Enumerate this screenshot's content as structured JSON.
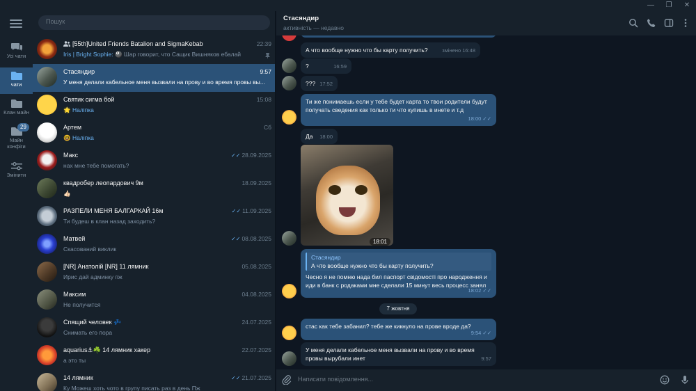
{
  "colors": {
    "accent": "#2b5278",
    "link": "#6ab2f2",
    "bg": "#0e1621",
    "panel": "#17212b"
  },
  "window": {
    "minimize": "—",
    "restore": "❐",
    "close": "✕"
  },
  "rail": {
    "badge": "29",
    "items": [
      {
        "label": "Усі чати",
        "icon": "chat-bubbles-icon"
      },
      {
        "label": "чати",
        "icon": "folder-icon"
      },
      {
        "label": "Клан майн",
        "icon": "folder-icon"
      },
      {
        "label": "Майн конфіги",
        "icon": "folder-icon"
      },
      {
        "label": "Змінити",
        "icon": "sliders-icon"
      }
    ]
  },
  "search": {
    "placeholder": "Пошук"
  },
  "chats": [
    {
      "name": "[55th]United Friends Batalion and SigmaKebab",
      "time": "22:39",
      "sender": "Iris | Bright Sophie:",
      "preview": "🎱 Шар говорит, что Сащик Вишняков ебалай"
    },
    {
      "name": "Стасяндир",
      "time": "9:57",
      "preview": "У меня делали кабельное меня вызвали на прову и во время провы вы..."
    },
    {
      "name": "Святик сигма бой",
      "time": "15:08",
      "preview": "🌟 Наліпка"
    },
    {
      "name": "Артем",
      "time": "Сб",
      "preview": "🤓 Наліпка"
    },
    {
      "name": "Макс",
      "time": "28.09.2025",
      "preview": "нах мне тебе помогать?"
    },
    {
      "name": "квадробер леопардович 9м",
      "time": "18.09.2025",
      "preview": "👍🏻"
    },
    {
      "name": "РАЗПЕЛИ МЕНЯ БАЛГАРКАЙ 16м",
      "time": "11.09.2025",
      "preview": "Ти будеш в клан назад заходить?"
    },
    {
      "name": "Матвей",
      "time": "08.08.2025",
      "preview": "Скасований виклик"
    },
    {
      "name": "[NR] Анатолій [NR] 11 лямник",
      "time": "05.08.2025",
      "preview": "Ирис дай админку пж"
    },
    {
      "name": "Максим",
      "time": "04.08.2025",
      "preview": "Не получится"
    },
    {
      "name": "Спящий человек 💤",
      "time": "24.07.2025",
      "preview": "Снимать его пора"
    },
    {
      "name": "aquarius⚓☘️ 14 лямник хакер",
      "time": "22.07.2025",
      "preview": "а это ты"
    },
    {
      "name": "14 лямник",
      "time": "21.07.2025",
      "preview": "Ку Можеш хоть чото в групу писать раз в день Пж"
    }
  ],
  "conversation": {
    "title": "Стасяндир",
    "status": "активність — недавно",
    "messages": [
      {
        "text": "А что вообще нужно что бы карту получить?",
        "time": "змінено 16:48"
      },
      {
        "text": "?",
        "time": "16:59"
      },
      {
        "text": "???",
        "time": "17:52"
      },
      {
        "text": "Ти же понимаешь если у тебе будет карта то твои родители будут получать сведения как только ти что купишь в инете и т.д",
        "time": "18:00"
      },
      {
        "text": "Да",
        "time": "18:00"
      },
      {
        "text": "",
        "time": "18:01"
      },
      {
        "reply_name": "Стасяндир",
        "reply_text": "А что вообще нужно что бы карту получить?",
        "text": "Чесно я не помню нада бил паспорт свідомості про народження и иди в банк с родаками мне сделали 15 минут весь процесс занял",
        "time": "18:02"
      },
      {
        "text": "стас как тебе забанил? тебе же кикнуло на прове вроде да?",
        "time": "9:54"
      },
      {
        "text": "У меня делали кабельное меня вызвали на прову и во время провы вырубали инет",
        "time": "9:57"
      }
    ],
    "date_divider": "7 жовтня",
    "composer_placeholder": "Написати повідомлення..."
  }
}
